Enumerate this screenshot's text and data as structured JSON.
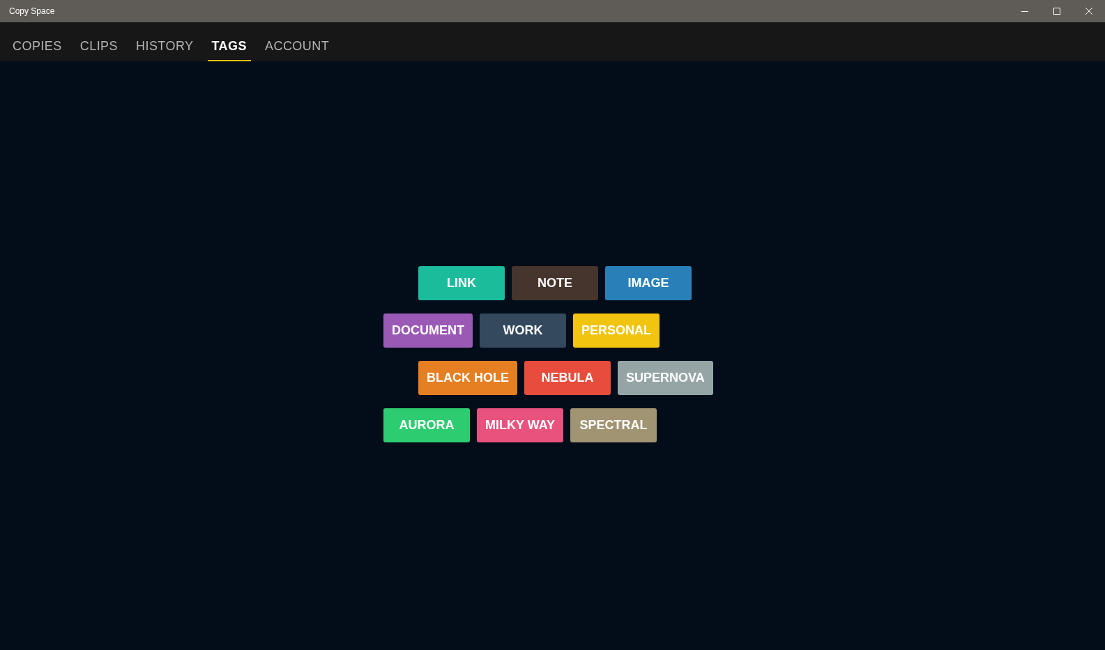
{
  "window": {
    "title": "Copy Space"
  },
  "tabs": [
    {
      "label": "COPIES",
      "selected": false
    },
    {
      "label": "CLIPS",
      "selected": false
    },
    {
      "label": "HISTORY",
      "selected": false
    },
    {
      "label": "TAGS",
      "selected": true
    },
    {
      "label": "ACCOUNT",
      "selected": false
    }
  ],
  "tag_rows": [
    [
      {
        "label": "LINK",
        "color": "#1abc9c"
      },
      {
        "label": "NOTE",
        "color": "#45352c"
      },
      {
        "label": "IMAGE",
        "color": "#2980b9"
      }
    ],
    [
      {
        "label": "DOCUMENT",
        "color": "#9b59b6"
      },
      {
        "label": "WORK",
        "color": "#34495e"
      },
      {
        "label": "PERSONAL",
        "color": "#f1c40f"
      }
    ],
    [
      {
        "label": "BLACK HOLE",
        "color": "#e67e22"
      },
      {
        "label": "NEBULA",
        "color": "#e74c3c"
      },
      {
        "label": "SUPERNOVA",
        "color": "#95a5a6"
      }
    ],
    [
      {
        "label": "AURORA",
        "color": "#2ecc71"
      },
      {
        "label": "MILKY WAY",
        "color": "#e8527c"
      },
      {
        "label": "SPECTRAL",
        "color": "#a19473"
      }
    ]
  ]
}
